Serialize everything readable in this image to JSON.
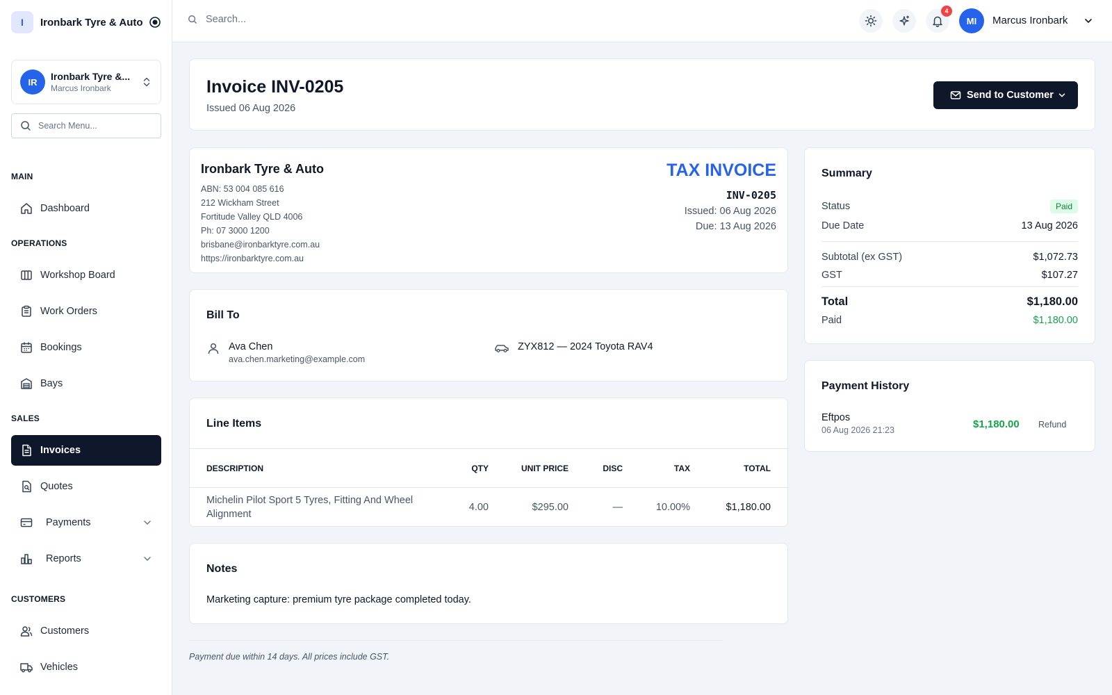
{
  "brand": {
    "initial": "I",
    "name": "Ironbark Tyre & Auto"
  },
  "org": {
    "initials": "IR",
    "name": "Ironbark Tyre &...",
    "user": "Marcus Ironbark"
  },
  "sidebar": {
    "search_placeholder": "Search Menu...",
    "sections": {
      "main": "MAIN",
      "operations": "OPERATIONS",
      "sales": "SALES",
      "customers": "CUSTOMERS"
    },
    "items": {
      "dashboard": "Dashboard",
      "workshop_board": "Workshop Board",
      "work_orders": "Work Orders",
      "bookings": "Bookings",
      "bays": "Bays",
      "invoices": "Invoices",
      "quotes": "Quotes",
      "payments": "Payments",
      "reports": "Reports",
      "customers": "Customers",
      "vehicles": "Vehicles"
    },
    "active": "invoices"
  },
  "topbar": {
    "search_placeholder": "Search...",
    "notification_count": "4",
    "user_initials": "MI",
    "user_name": "Marcus Ironbark"
  },
  "header": {
    "title": "Invoice INV-0205",
    "issued": "Issued 06 Aug 2026",
    "send_label": "Send to Customer"
  },
  "invoice": {
    "company": "Ironbark Tyre & Auto",
    "abn": "ABN: 53 004 085 616",
    "street": "212 Wickham Street",
    "suburb": "Fortitude Valley QLD 4006",
    "phone": "Ph: 07 3000 1200",
    "email": "brisbane@ironbarktyre.com.au",
    "website": "https://ironbarktyre.com.au",
    "doc_title": "TAX INVOICE",
    "number": "INV-0205",
    "issued": "Issued: 06 Aug 2026",
    "due": "Due: 13 Aug 2026"
  },
  "bill_to": {
    "title": "Bill To",
    "name": "Ava Chen",
    "email": "ava.chen.marketing@example.com",
    "vehicle": "ZYX812 — 2024 Toyota RAV4"
  },
  "line_items": {
    "title": "Line Items",
    "columns": [
      "DESCRIPTION",
      "QTY",
      "UNIT PRICE",
      "DISC",
      "TAX",
      "TOTAL"
    ],
    "rows": [
      [
        "Michelin Pilot Sport 5 Tyres, Fitting And Wheel Alignment",
        "4.00",
        "$295.00",
        "—",
        "10.00%",
        "$1,180.00"
      ]
    ]
  },
  "notes": {
    "title": "Notes",
    "text": "Marketing capture: premium tyre package completed today."
  },
  "summary": {
    "title": "Summary",
    "status_label": "Status",
    "status_value": "Paid",
    "due_label": "Due Date",
    "due_value": "13 Aug 2026",
    "subtotal_label": "Subtotal (ex GST)",
    "subtotal_value": "$1,072.73",
    "gst_label": "GST",
    "gst_value": "$107.27",
    "total_label": "Total",
    "total_value": "$1,180.00",
    "paid_label": "Paid",
    "paid_value": "$1,180.00"
  },
  "payment_history": {
    "title": "Payment History",
    "method": "Eftpos",
    "date": "06 Aug 2026 21:23",
    "amount": "$1,180.00",
    "refund_label": "Refund"
  },
  "footer": {
    "note": "Payment due within 14 days. All prices include GST."
  },
  "colors": {
    "accent": "#2563eb",
    "dark": "#0f172a",
    "success": "#16a34a",
    "danger": "#ef4444"
  }
}
